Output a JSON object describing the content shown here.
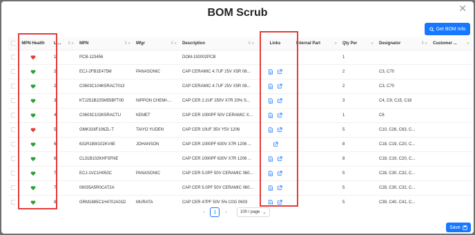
{
  "modal": {
    "title": "BOM Scrub"
  },
  "toolbar": {
    "get_bom_info_label": "Get BOM Info"
  },
  "columns": [
    "MPN Health",
    "Li...",
    "MPN",
    "Mfgr",
    "Description",
    "Links",
    "Internal Part",
    "Qty Per",
    "Designator",
    "Customer ..."
  ],
  "rows": [
    {
      "health": "red",
      "line": "1",
      "mpn": "PCB-123456",
      "mfgr": "",
      "desc": "DOM-192002PCB",
      "links": "none",
      "internal": "",
      "qty": "1",
      "designator": ""
    },
    {
      "health": "green",
      "line": "2",
      "mpn": "ECJ-2FB1E475M",
      "mfgr": "PANASONIC",
      "desc": "CAP CERAMIC 4.7UF 25V X5R 08...",
      "links": "both",
      "internal": "",
      "qty": "2",
      "designator": "C3, C70"
    },
    {
      "health": "green",
      "line": "2",
      "mpn": "C0603C104K5RAC7013",
      "mfgr": "",
      "desc": "CAP CERAMIC 4.7UF 25V X5R 08...",
      "links": "both",
      "internal": "",
      "qty": "2",
      "designator": "C3, C70"
    },
    {
      "health": "green",
      "line": "3",
      "mpn": "KTJ251B225M55BFT00",
      "mfgr": "NIPPON CHEMI-...",
      "desc": "CAP CER 2.2UF 250V X7R 20% S...",
      "links": "both",
      "internal": "",
      "qty": "3",
      "designator": "C4, C9, C15, C16"
    },
    {
      "health": "green",
      "line": "4",
      "mpn": "C0603C102K5RACTU",
      "mfgr": "KEMET",
      "desc": "CAP CER 1000PF 50V CERAMIC X7R 0...",
      "links": "both",
      "internal": "",
      "qty": "1",
      "designator": "C6"
    },
    {
      "health": "red",
      "line": "5",
      "mpn": "GMK316F106ZL-T",
      "mfgr": "TAIYO YUDEN",
      "desc": "CAP CER 10UF 35V Y5V 1206",
      "links": "both",
      "internal": "",
      "qty": "5",
      "designator": "C10, C26, C63, C..."
    },
    {
      "health": "green",
      "line": "6",
      "mpn": "631R18W102KV4E",
      "mfgr": "JOHANSON",
      "desc": "CAP CER 1000PF 630V X7R 1206 ...",
      "links": "ext",
      "internal": "",
      "qty": "8",
      "designator": "C18, C19, C20, C..."
    },
    {
      "health": "green",
      "line": "6",
      "mpn": "CL31B102KHFSFNE",
      "mfgr": "",
      "desc": "CAP CER 1000PF 630V X7R 1206 ...",
      "links": "both",
      "internal": "",
      "qty": "8",
      "designator": "C18, C19, C20, C..."
    },
    {
      "health": "green",
      "line": "7",
      "mpn": "ECJ-1VC1H050C",
      "mfgr": "PANASONIC",
      "desc": "CAP CER 5.0PF 50V CERAMIC 0603 S...",
      "links": "both",
      "internal": "",
      "qty": "5",
      "designator": "C28, C30, C32, C..."
    },
    {
      "health": "green",
      "line": "7",
      "mpn": "06035A5R0CAT2A",
      "mfgr": "",
      "desc": "CAP CER 5.0PF 50V CERAMIC 0603 S...",
      "links": "both",
      "internal": "",
      "qty": "5",
      "designator": "C28, C30, C32, C..."
    },
    {
      "health": "green",
      "line": "8",
      "mpn": "GRM1885C1H470JA01D",
      "mfgr": "MURATA",
      "desc": "CAP CER 47PF 50V 5% C0G 0603",
      "links": "both",
      "internal": "",
      "qty": "5",
      "designator": "C39, C40, C41, C..."
    }
  ],
  "pagination": {
    "current_page": "1",
    "prev": "‹",
    "next": "›",
    "page_size": "100 / page"
  },
  "footer": {
    "save_label": "Save"
  },
  "icons": {
    "close": "close-icon",
    "search": "search-icon",
    "sort": "sort-icon",
    "file": "file-icon",
    "external": "external-link-icon",
    "save": "save-icon"
  },
  "colors": {
    "accent": "#1677ff",
    "health_green": "#2e9e3a",
    "health_red": "#e53935",
    "highlight": "#e53935"
  }
}
